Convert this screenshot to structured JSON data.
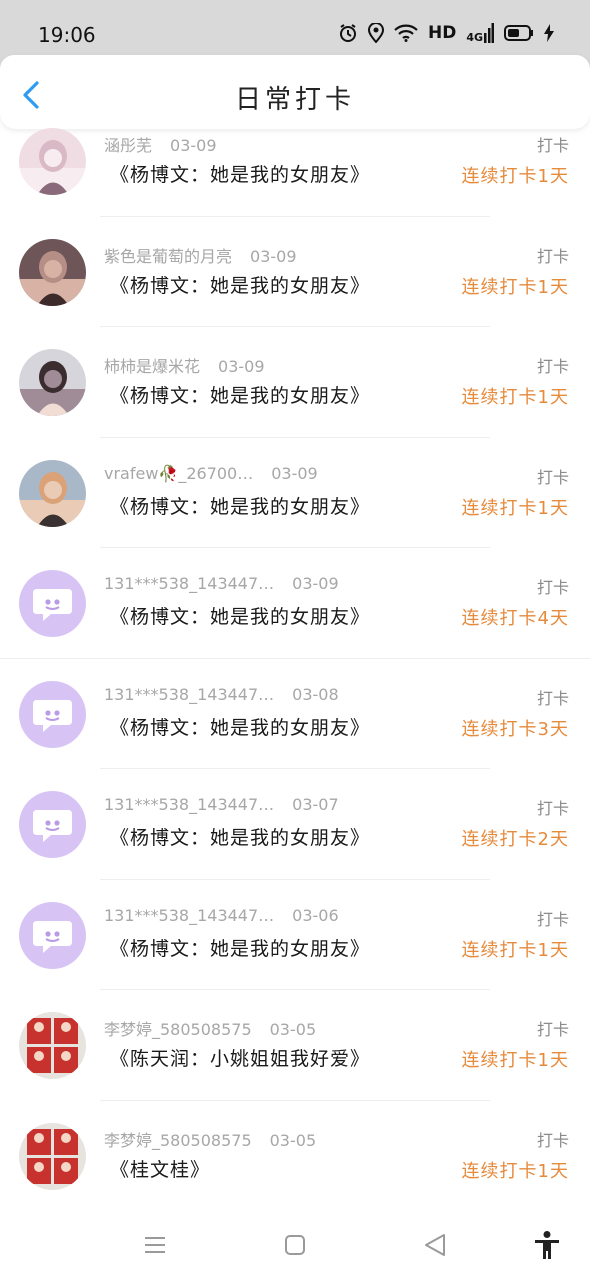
{
  "status_bar": {
    "time": "19:06",
    "hd": "HD",
    "network": "4G",
    "icons": [
      "alarm-icon",
      "location-icon",
      "wifi-icon",
      "battery-icon",
      "charging-icon"
    ]
  },
  "header": {
    "title": "日常打卡",
    "back_icon": "chevron-left-icon",
    "accent_color": "#2f9cf3"
  },
  "colors": {
    "streak": "#e68a3c",
    "meta": "#a7a7a7",
    "default_avatar": "#d7c4f5"
  },
  "entries": [
    {
      "user": "涵彤芜",
      "date": "03-09",
      "book": "《杨博文：她是我的女朋友》",
      "action": "打卡",
      "streak": "连续打卡1天",
      "avatar": "photo-1"
    },
    {
      "user": "紫色是葡萄的月亮",
      "date": "03-09",
      "book": "《杨博文：她是我的女朋友》",
      "action": "打卡",
      "streak": "连续打卡1天",
      "avatar": "photo-2"
    },
    {
      "user": "柿柿是爆米花",
      "date": "03-09",
      "book": "《杨博文：她是我的女朋友》",
      "action": "打卡",
      "streak": "连续打卡1天",
      "avatar": "photo-3"
    },
    {
      "user": "vrafew🥀_26700…",
      "date": "03-09",
      "book": "《杨博文：她是我的女朋友》",
      "action": "打卡",
      "streak": "连续打卡1天",
      "avatar": "photo-4"
    },
    {
      "user": "131***538_143447…",
      "date": "03-09",
      "book": "《杨博文：她是我的女朋友》",
      "action": "打卡",
      "streak": "连续打卡4天",
      "avatar": "default"
    },
    {
      "user": "131***538_143447…",
      "date": "03-08",
      "book": "《杨博文：她是我的女朋友》",
      "action": "打卡",
      "streak": "连续打卡3天",
      "avatar": "default"
    },
    {
      "user": "131***538_143447…",
      "date": "03-07",
      "book": "《杨博文：她是我的女朋友》",
      "action": "打卡",
      "streak": "连续打卡2天",
      "avatar": "default"
    },
    {
      "user": "131***538_143447…",
      "date": "03-06",
      "book": "《杨博文：她是我的女朋友》",
      "action": "打卡",
      "streak": "连续打卡1天",
      "avatar": "default"
    },
    {
      "user": "李梦婷_580508575",
      "date": "03-05",
      "book": "《陈天润：小姚姐姐我好爱》",
      "action": "打卡",
      "streak": "连续打卡1天",
      "avatar": "photo-5"
    },
    {
      "user": "李梦婷_580508575",
      "date": "03-05",
      "book": "《桂文桂》",
      "action": "打卡",
      "streak": "连续打卡1天",
      "avatar": "photo-5"
    }
  ],
  "nav": {
    "items": [
      "menu-icon",
      "home-icon",
      "back-triangle-icon",
      "accessibility-icon"
    ]
  }
}
